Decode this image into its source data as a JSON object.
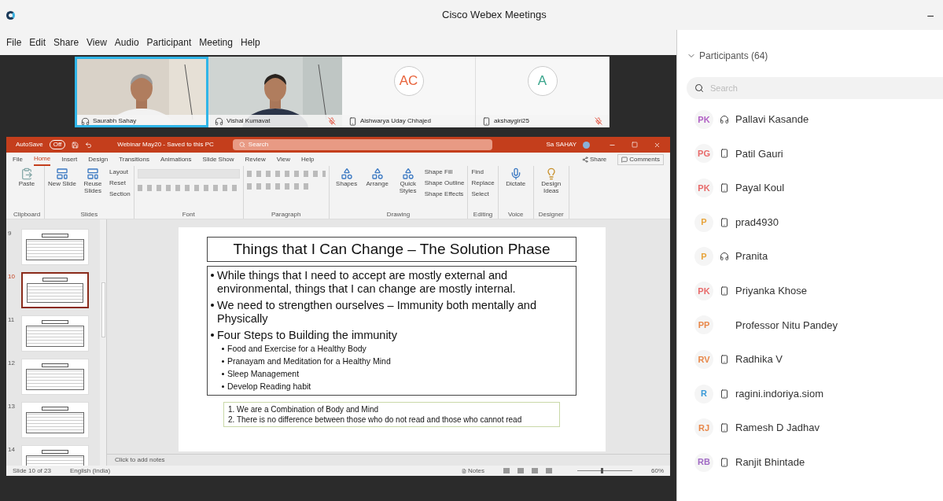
{
  "window": {
    "title": "Cisco Webex Meetings",
    "minimize": "–"
  },
  "menu": [
    "File",
    "Edit",
    "Share",
    "View",
    "Audio",
    "Participant",
    "Meeting",
    "Help"
  ],
  "video_tiles": [
    {
      "kind": "video",
      "name": "Saurabh Sahay",
      "selected": true,
      "muted": false,
      "on_phone": false
    },
    {
      "kind": "video",
      "name": "Vishal Kumavat",
      "selected": false,
      "muted": true,
      "on_phone": false
    },
    {
      "kind": "avatar",
      "initials": "AC",
      "color": "#e8643c",
      "name": "Aishwarya Uday Chhajed",
      "selected": false,
      "muted": false,
      "on_phone": true
    },
    {
      "kind": "avatar",
      "initials": "A",
      "color": "#3aa58c",
      "name": "akshaygiri25",
      "selected": false,
      "muted": true,
      "on_phone": true
    }
  ],
  "powerpoint": {
    "title_bar": {
      "autosave": "AutoSave",
      "toggle": "Off",
      "document": "Webinar May20 - Saved to this PC",
      "search": "Search",
      "user": "Sa SAHAY"
    },
    "tabs": [
      {
        "label": "File",
        "selected": false
      },
      {
        "label": "Home",
        "selected": true
      },
      {
        "label": "Insert",
        "selected": false
      },
      {
        "label": "Design",
        "selected": false
      },
      {
        "label": "Transitions",
        "selected": false
      },
      {
        "label": "Animations",
        "selected": false
      },
      {
        "label": "Slide Show",
        "selected": false
      },
      {
        "label": "Review",
        "selected": false
      },
      {
        "label": "View",
        "selected": false
      },
      {
        "label": "Help",
        "selected": false
      }
    ],
    "share": "Share",
    "comments": "Comments",
    "groups": [
      {
        "label": "Clipboard",
        "items": [
          {
            "kind": "large",
            "label": "Paste"
          }
        ]
      },
      {
        "label": "Slides",
        "items": [
          {
            "kind": "large",
            "label": "New Slide"
          },
          {
            "kind": "large",
            "label": "Reuse Slides"
          },
          {
            "kind": "small",
            "label": "Layout"
          },
          {
            "kind": "small",
            "label": "Reset"
          },
          {
            "kind": "small",
            "label": "Section"
          }
        ]
      },
      {
        "label": "Font",
        "items": [
          {
            "kind": "font"
          }
        ]
      },
      {
        "label": "Paragraph",
        "items": [
          {
            "kind": "paragraph"
          }
        ]
      },
      {
        "label": "Drawing",
        "items": [
          {
            "kind": "large",
            "label": "Shapes"
          },
          {
            "kind": "large",
            "label": "Arrange"
          },
          {
            "kind": "large",
            "label": "Quick Styles"
          },
          {
            "kind": "small",
            "label": "Shape Fill"
          },
          {
            "kind": "small",
            "label": "Shape Outline"
          },
          {
            "kind": "small",
            "label": "Shape Effects"
          }
        ]
      },
      {
        "label": "Editing",
        "items": [
          {
            "kind": "small",
            "label": "Find"
          },
          {
            "kind": "small",
            "label": "Replace"
          },
          {
            "kind": "small",
            "label": "Select"
          }
        ]
      },
      {
        "label": "Voice",
        "items": [
          {
            "kind": "large",
            "label": "Dictate"
          }
        ]
      },
      {
        "label": "Designer",
        "items": [
          {
            "kind": "large",
            "label": "Design Ideas"
          }
        ]
      }
    ],
    "thumbnails": [
      {
        "number": "9",
        "selected": false
      },
      {
        "number": "10",
        "selected": true
      },
      {
        "number": "11",
        "selected": false
      },
      {
        "number": "12",
        "selected": false
      },
      {
        "number": "13",
        "selected": false
      },
      {
        "number": "14",
        "selected": false
      }
    ],
    "slide": {
      "title": "Things that I Can Change – The Solution Phase",
      "bullets": [
        {
          "text": "While things that I need to accept are mostly external and environmental, things that I can change are mostly internal."
        },
        {
          "text": "We need to strengthen ourselves – Immunity both mentally and Physically"
        },
        {
          "text": "Four Steps to Building the immunity",
          "children": [
            {
              "text": "Food and Exercise for a Healthy Body"
            },
            {
              "text": "Pranayam and Meditation for a Healthy Mind"
            },
            {
              "text": "Sleep Management"
            },
            {
              "text": "Develop Reading habit"
            }
          ]
        }
      ],
      "note_lines": [
        "1. We are a Combination of Body and Mind",
        "2. There is no difference between those who do not read and those who cannot read"
      ]
    },
    "notes_placeholder": "Click to add notes",
    "status": {
      "slide": "Slide 10 of 23",
      "language": "English (India)",
      "notes": "Notes",
      "zoom_slider": {
        "level": 0.45
      },
      "zoom": "60%"
    }
  },
  "participants": {
    "title": "Participants (64)",
    "search_placeholder": "Search",
    "items": [
      {
        "kind": "headset",
        "initials": "PK",
        "color": "#b05fc4",
        "name": "Pallavi Kasande"
      },
      {
        "kind": "phone",
        "initials": "PG",
        "color": "#e86a6a",
        "name": "Patil Gauri"
      },
      {
        "kind": "phone",
        "initials": "PK",
        "color": "#e86a6a",
        "name": "Payal Koul"
      },
      {
        "kind": "phone",
        "initials": "P",
        "color": "#e8a43c",
        "name": "prad4930"
      },
      {
        "kind": "headset",
        "initials": "P",
        "color": "#e8a43c",
        "name": "Pranita"
      },
      {
        "kind": "phone",
        "initials": "PK",
        "color": "#e86a6a",
        "name": "Priyanka Khose"
      },
      {
        "kind": "none",
        "initials": "PP",
        "color": "#e8884a",
        "name": "Professor Nitu Pandey"
      },
      {
        "kind": "phone",
        "initials": "RV",
        "color": "#e8884a",
        "name": "Radhika V"
      },
      {
        "kind": "phone",
        "initials": "R",
        "color": "#3a9ad8",
        "name": "ragini.indoriya.siom"
      },
      {
        "kind": "phone",
        "initials": "RJ",
        "color": "#e8884a",
        "name": "Ramesh D Jadhav"
      },
      {
        "kind": "phone",
        "initials": "RB",
        "color": "#a06ac4",
        "name": "Ranjit Bhintade"
      }
    ]
  }
}
